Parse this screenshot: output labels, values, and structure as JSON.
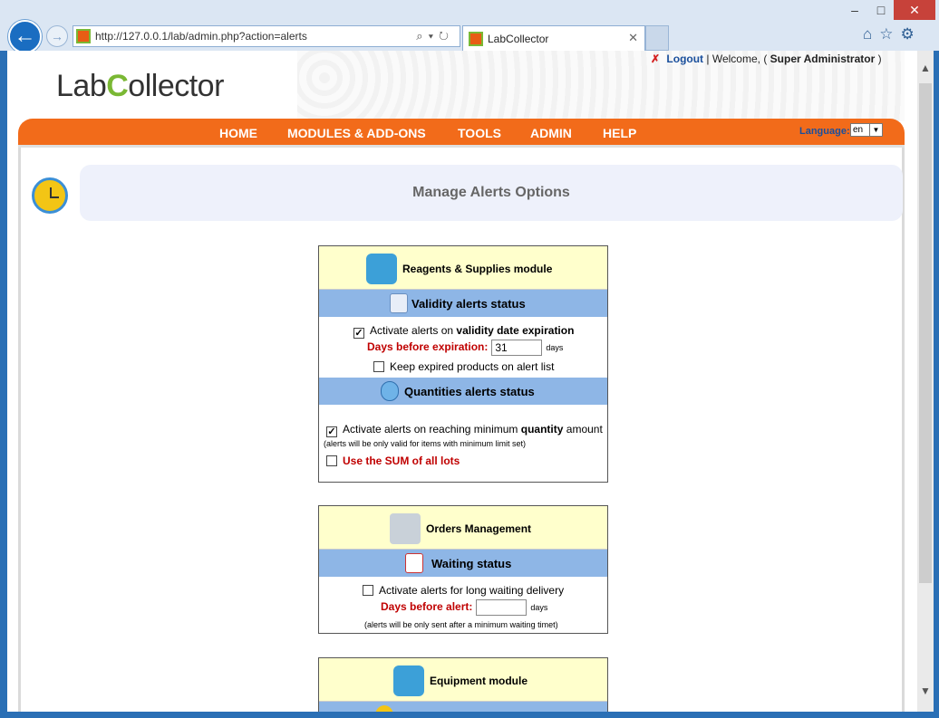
{
  "browser": {
    "url": "http://127.0.0.1/lab/admin.php?action=alerts",
    "tab_title": "LabCollector",
    "window_controls": {
      "minimize": "–",
      "maximize": "□",
      "close": "✕"
    }
  },
  "header": {
    "logo_text_a": "Lab",
    "logo_text_b": "C",
    "logo_text_c": "ollector",
    "logout_label": "Logout",
    "welcome_text": "| Welcome, (",
    "user_name": "Super Administrator",
    "welcome_end": ")"
  },
  "menu": {
    "items": [
      {
        "label": "HOME"
      },
      {
        "label": "MODULES & ADD-ONS"
      },
      {
        "label": "TOOLS"
      },
      {
        "label": "ADMIN"
      },
      {
        "label": "HELP"
      }
    ],
    "language_label": "Language:",
    "language_value": "en"
  },
  "page": {
    "title": "Manage Alerts Options"
  },
  "reagents": {
    "module_title": "Reagents & Supplies module",
    "validity_title": "Validity alerts status",
    "validity_activate_prefix": "Activate alerts on",
    "validity_activate_bold": "validity date expiration",
    "validity_checked": true,
    "days_before_label": "Days before expiration:",
    "days_before_value": "31",
    "days_unit": "days",
    "keep_expired_label": "Keep expired products on alert list",
    "keep_expired_checked": false,
    "quantities_title": "Quantities alerts status",
    "quantity_activate_prefix": "Activate alerts on reaching minimum",
    "quantity_activate_bold": "quantity",
    "quantity_activate_suffix": "amount",
    "quantity_checked": true,
    "quantity_note": "(alerts will be only valid for items with minimum limit set)",
    "sum_lots_label": "Use the SUM of all lots",
    "sum_lots_checked": false
  },
  "orders": {
    "module_title": "Orders Management",
    "waiting_title": "Waiting status",
    "waiting_activate_label": "Activate alerts for long waiting delivery",
    "waiting_checked": false,
    "days_before_alert_label": "Days before alert:",
    "days_before_alert_value": "",
    "days_unit": "days",
    "note": "(alerts will be only sent after a minimum waiting timet)"
  },
  "equipment": {
    "module_title": "Equipment module"
  }
}
